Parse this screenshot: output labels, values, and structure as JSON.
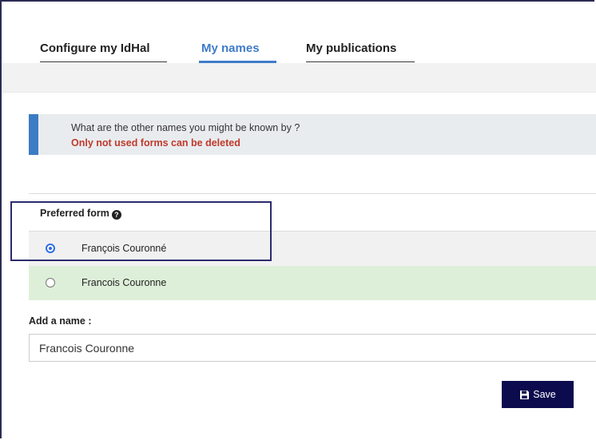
{
  "tabs": [
    {
      "label": "Configure my IdHal",
      "active": false
    },
    {
      "label": "My names",
      "active": true
    },
    {
      "label": "My publications",
      "active": false
    }
  ],
  "info": {
    "question": "What are the other names you might be known by ?",
    "warning": "Only not used forms can be deleted"
  },
  "preferred": {
    "title": "Preferred form",
    "options": [
      {
        "name": "François Couronné",
        "selected": true
      },
      {
        "name": "Francois Couronne",
        "selected": false
      }
    ]
  },
  "add_name": {
    "label": "Add a name :",
    "value": "Francois Couronne"
  },
  "save_label": "Save",
  "colors": {
    "accent": "#3f7cc9",
    "warning": "#c0392b",
    "save_bg": "#0c0b4e",
    "row_highlight": "#deefd9"
  }
}
